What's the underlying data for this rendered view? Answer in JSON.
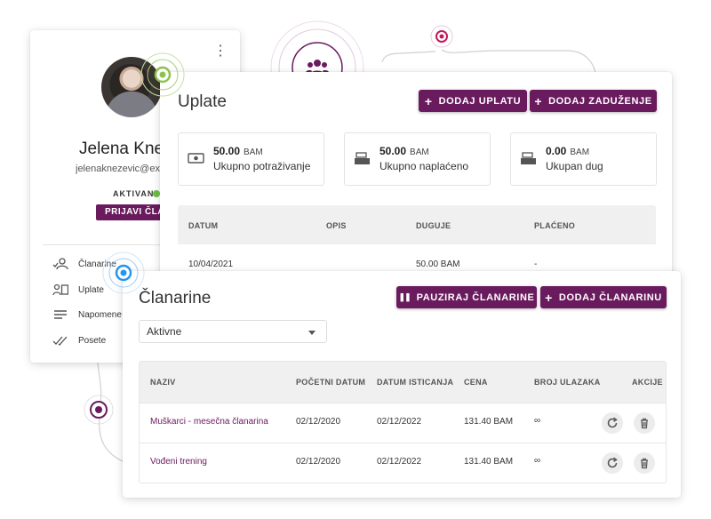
{
  "colors": {
    "brand": "#6a1b5e",
    "active": "#6abf40",
    "ring_green": "#8bc34a",
    "ring_blue": "#2196f3"
  },
  "profile": {
    "name": "Jelena Knež",
    "email": "jelenaknezevic@exam",
    "status": "AKTIVAN",
    "join_button": "PRIJAVI ČLAN",
    "menu": [
      {
        "label": "Članarine",
        "icon": "members-icon"
      },
      {
        "label": "Uplate",
        "icon": "payments-icon"
      },
      {
        "label": "Napomene",
        "icon": "notes-icon"
      },
      {
        "label": "Posete",
        "icon": "visits-icon"
      }
    ]
  },
  "uplate": {
    "title": "Uplate",
    "add_payment_label": "DODAJ UPLATU",
    "add_charge_label": "DODAJ ZADUŽENJE",
    "stats": [
      {
        "value": "50.00",
        "unit": "BAM",
        "label": "Ukupno potraživanje",
        "icon": "cash-icon"
      },
      {
        "value": "50.00",
        "unit": "BAM",
        "label": "Ukupno naplaćeno",
        "icon": "register-icon"
      },
      {
        "value": "0.00",
        "unit": "BAM",
        "label": "Ukupan dug",
        "icon": "register-icon"
      }
    ],
    "columns": [
      "DATUM",
      "OPIS",
      "DUGUJE",
      "PLAĆENO"
    ],
    "rows": [
      {
        "datum": "10/04/2021",
        "opis": "",
        "duguje": "50.00 BAM",
        "placeno": "-"
      }
    ]
  },
  "clanarine": {
    "title": "Članarine",
    "pause_label": "PAUZIRAJ ČLANARINE",
    "add_label": "DODAJ ČLANARINU",
    "filter_value": "Aktivne",
    "columns": [
      "NAZIV",
      "POČETNI DATUM",
      "DATUM ISTICANJA",
      "CENA",
      "BROJ ULAZAKA",
      "AKCIJE"
    ],
    "rows": [
      {
        "naziv": "Muškarci - mesečna članarina",
        "start": "02/12/2020",
        "end": "02/12/2022",
        "cena": "131.40 BAM",
        "ulazi": "∞"
      },
      {
        "naziv": "Vođeni trening",
        "start": "02/12/2020",
        "end": "02/12/2022",
        "cena": "131.40 BAM",
        "ulazi": "∞"
      }
    ]
  }
}
